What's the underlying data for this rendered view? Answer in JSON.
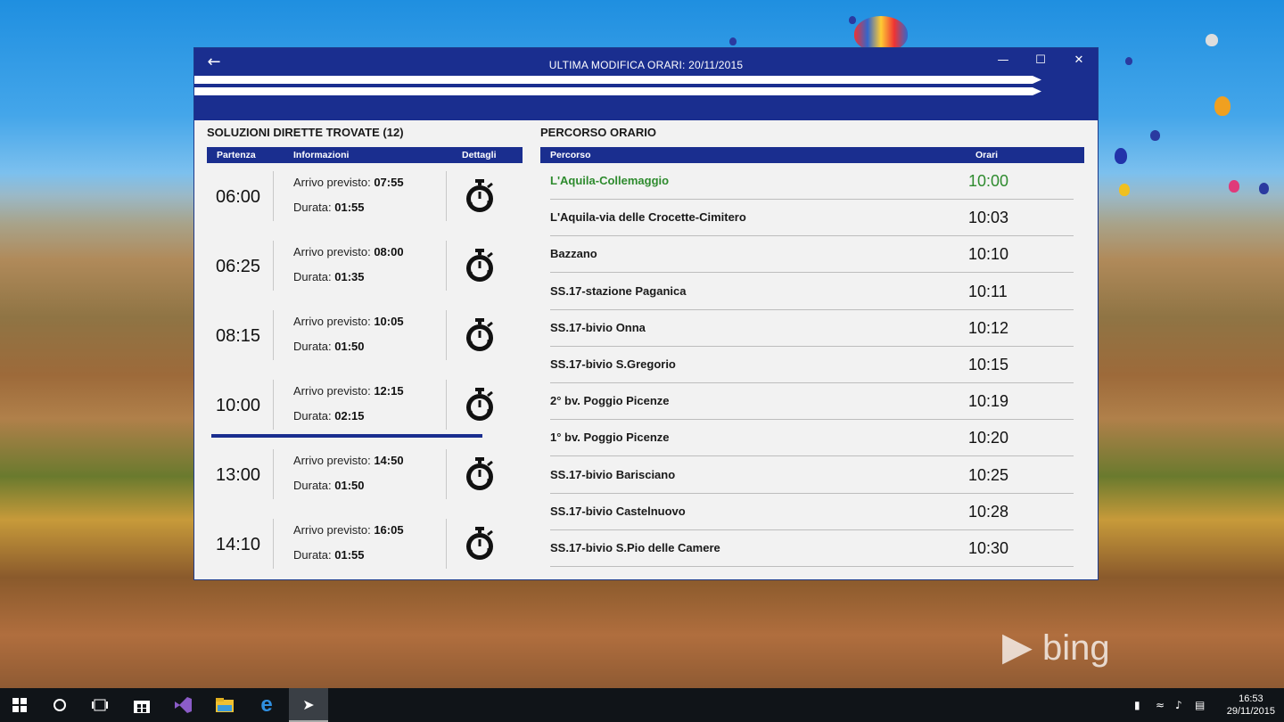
{
  "window": {
    "title": "ULTIMA MODIFICA ORARI: 20/11/2015",
    "back_icon": "arrow-left-icon",
    "minimize_icon": "minimize-icon",
    "maximize_icon": "maximize-icon",
    "close_icon": "close-icon"
  },
  "solutions": {
    "title": "SOLUZIONI DIRETTE TROVATE (12)",
    "columns": [
      "Partenza",
      "Informazioni",
      "Dettagli"
    ],
    "arrival_label": "Arrivo previsto:",
    "duration_label": "Durata:",
    "selected_index": 3,
    "rows": [
      {
        "departure": "06:00",
        "arrival": "07:55",
        "duration": "01:55"
      },
      {
        "departure": "06:25",
        "arrival": "08:00",
        "duration": "01:35"
      },
      {
        "departure": "08:15",
        "arrival": "10:05",
        "duration": "01:50"
      },
      {
        "departure": "10:00",
        "arrival": "12:15",
        "duration": "02:15"
      },
      {
        "departure": "13:00",
        "arrival": "14:50",
        "duration": "01:50"
      },
      {
        "departure": "14:10",
        "arrival": "16:05",
        "duration": "01:55"
      }
    ]
  },
  "route": {
    "title": "PERCORSO ORARIO",
    "columns": [
      "Percorso",
      "Orari"
    ],
    "stops": [
      {
        "name": "L'Aquila-Collemaggio",
        "time": "10:00"
      },
      {
        "name": "L'Aquila-via delle Crocette-Cimitero",
        "time": "10:03"
      },
      {
        "name": "Bazzano",
        "time": "10:10"
      },
      {
        "name": "SS.17-stazione Paganica",
        "time": "10:11"
      },
      {
        "name": "SS.17-bivio Onna",
        "time": "10:12"
      },
      {
        "name": "SS.17-bivio S.Gregorio",
        "time": "10:15"
      },
      {
        "name": "2° bv. Poggio Picenze",
        "time": "10:19"
      },
      {
        "name": "1° bv. Poggio Picenze",
        "time": "10:20"
      },
      {
        "name": "SS.17-bivio Barisciano",
        "time": "10:25"
      },
      {
        "name": "SS.17-bivio Castelnuovo",
        "time": "10:28"
      },
      {
        "name": "SS.17-bivio S.Pio delle Camere",
        "time": "10:30"
      }
    ]
  },
  "colors": {
    "accent": "#1a2e8f",
    "first_stop": "#2e8b2e"
  },
  "desktop": {
    "watermark": "bing"
  },
  "taskbar": {
    "icons": [
      "windows-start-icon",
      "cortana-circle-icon",
      "task-view-icon",
      "store-icon",
      "visual-studio-icon",
      "file-explorer-icon",
      "edge-icon",
      "bus-app-icon"
    ],
    "time": "16:53",
    "date": "29/11/2015"
  }
}
